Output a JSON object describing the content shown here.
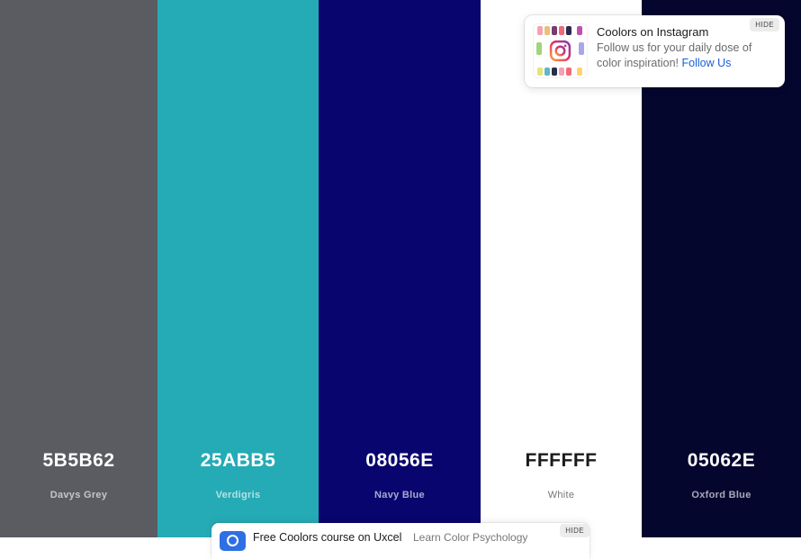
{
  "palette": {
    "colors": [
      {
        "hex": "5B5B62",
        "name": "Davys Grey",
        "bg": "#5B5B62"
      },
      {
        "hex": "25ABB5",
        "name": "Verdigris",
        "bg": "#25ABB5"
      },
      {
        "hex": "08056E",
        "name": "Navy Blue",
        "bg": "#08056E"
      },
      {
        "hex": "FFFFFF",
        "name": "White",
        "bg": "#FFFFFF"
      },
      {
        "hex": "05062E",
        "name": "Oxford Blue",
        "bg": "#05062E"
      }
    ]
  },
  "instagram_promo": {
    "title": "Coolors on Instagram",
    "description": "Follow us for your daily dose of color inspiration!",
    "link_label": "Follow Us",
    "hide_label": "HIDE",
    "thumbnail_icon": "instagram-icon"
  },
  "course_banner": {
    "title": "Free Coolors course on Uxcel",
    "subtitle": "Learn Color Psychology",
    "hide_label": "HIDE",
    "icon": "uxcel-logo-icon"
  }
}
